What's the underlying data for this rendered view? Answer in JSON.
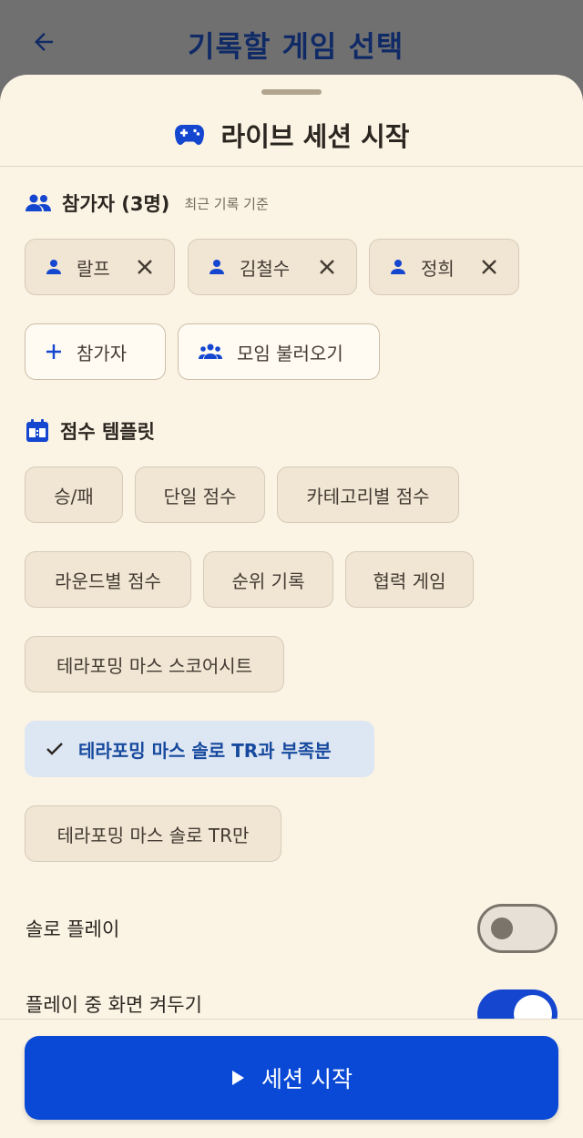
{
  "header": {
    "title": "기록할 게임 선택"
  },
  "sheet": {
    "title": "라이브 세션 시작",
    "participants": {
      "title": "참가자 (3명)",
      "subtitle": "최근 기록 기준",
      "players": [
        {
          "name": "랄프"
        },
        {
          "name": "김철수"
        },
        {
          "name": "정희"
        }
      ],
      "add_label": "참가자",
      "load_group_label": "모임 불러오기"
    },
    "templates": {
      "title": "점수 템플릿",
      "options": [
        {
          "label": "승/패",
          "selected": false
        },
        {
          "label": "단일 점수",
          "selected": false
        },
        {
          "label": "카테고리별 점수",
          "selected": false
        },
        {
          "label": "라운드별 점수",
          "selected": false
        },
        {
          "label": "순위 기록",
          "selected": false
        },
        {
          "label": "협력 게임",
          "selected": false
        },
        {
          "label": "테라포밍 마스 스코어시트",
          "selected": false
        },
        {
          "label": "테라포밍 마스 솔로 TR과 부족분",
          "selected": true
        },
        {
          "label": "테라포밍 마스 솔로 TR만",
          "selected": false
        }
      ]
    },
    "settings": [
      {
        "label": "솔로 플레이",
        "enabled": false
      },
      {
        "label": "플레이 중 화면 켜두기",
        "enabled": true
      }
    ]
  },
  "footer": {
    "start_label": "세션 시작"
  },
  "colors": {
    "accent": "#0a49d6",
    "sheet_bg": "#fbf3e4",
    "chip_bg": "#f1e5d3",
    "selected_bg": "#dde6f3",
    "selected_text": "#174a9e"
  }
}
